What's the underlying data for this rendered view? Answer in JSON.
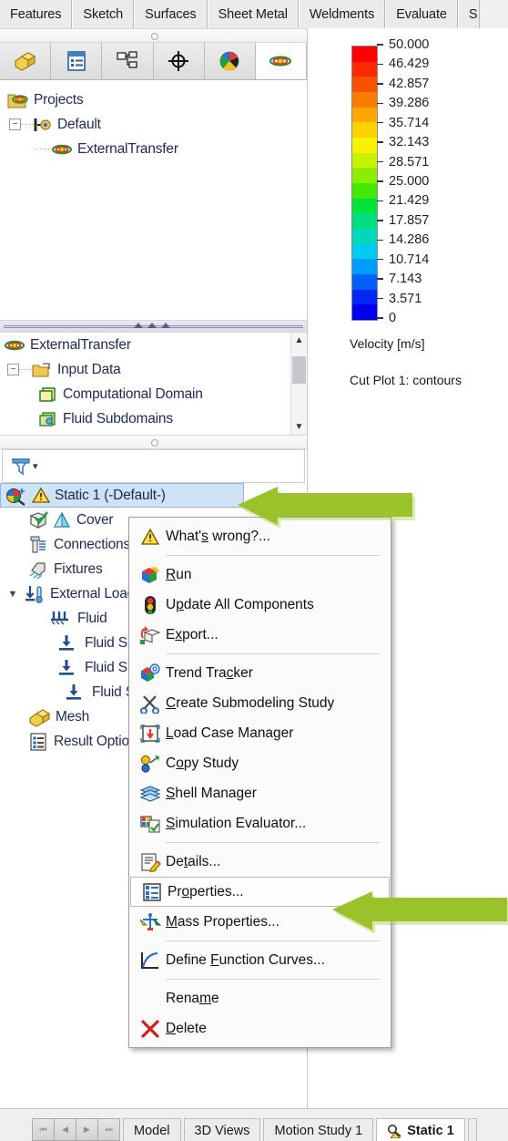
{
  "command_tabs": [
    {
      "label": "Features",
      "icon": "features-tab"
    },
    {
      "label": "Sketch",
      "icon": "sketch-tab"
    },
    {
      "label": "Surfaces",
      "icon": "surfaces-tab"
    },
    {
      "label": "Sheet Metal",
      "icon": "sheet-metal-tab"
    },
    {
      "label": "Weldments",
      "icon": "weldments-tab"
    },
    {
      "label": "Evaluate",
      "icon": "evaluate-tab"
    },
    {
      "label": "S",
      "icon": "simulation-tab-partial"
    }
  ],
  "feature_manager_tabs": [
    {
      "name": "feature-manager-design-tree-icon",
      "active": false
    },
    {
      "name": "property-manager-icon",
      "active": false
    },
    {
      "name": "configuration-manager-icon",
      "active": false
    },
    {
      "name": "dimxpert-manager-icon",
      "active": false
    },
    {
      "name": "display-manager-icon",
      "active": false
    },
    {
      "name": "flow-simulation-analysis-tree-icon",
      "active": true
    }
  ],
  "flow_tree": {
    "items": [
      {
        "label": "Projects",
        "icon": "projects-folder-icon",
        "depth": 0,
        "expander": null
      },
      {
        "label": "Default",
        "icon": "default-config-icon",
        "depth": 1,
        "expander": "minus"
      },
      {
        "label": "ExternalTransfer",
        "icon": "flow-project-icon",
        "depth": 2,
        "expander": null
      }
    ]
  },
  "input_tree": {
    "items": [
      {
        "label": "ExternalTransfer",
        "icon": "flow-project-icon",
        "depth": 0,
        "expander": null
      },
      {
        "label": "Input Data",
        "icon": "input-data-folder-icon",
        "depth": 1,
        "expander": "minus"
      },
      {
        "label": "Computational Domain",
        "icon": "computational-domain-icon",
        "depth": 2,
        "expander": null
      },
      {
        "label": "Fluid Subdomains",
        "icon": "fluid-subdomains-icon",
        "depth": 2,
        "expander": null
      }
    ],
    "scrollbar": {
      "up": "▲",
      "down": "▼"
    }
  },
  "filter_bar": {
    "icon": "filter-funnel-icon",
    "caret": "▾"
  },
  "sim_tree": {
    "items": [
      {
        "label": "Static 1 (-Default-)",
        "icon": "study-icon",
        "warn": true,
        "depth": 0,
        "selected": true,
        "expander": null
      },
      {
        "label": "Cover",
        "icon": "part-check-icon",
        "icon2": "solid-body-icon",
        "depth": 1,
        "selected": false,
        "expander": null
      },
      {
        "label": "Connections",
        "icon": "connections-icon",
        "depth": 1,
        "selected": false,
        "expander": null
      },
      {
        "label": "Fixtures",
        "icon": "fixtures-icon",
        "depth": 1,
        "selected": false,
        "expander": null
      },
      {
        "label": "External Loads",
        "icon": "external-loads-icon",
        "depth": 1,
        "selected": false,
        "expander": "caret-down"
      },
      {
        "label": "Fluid ",
        "icon": "fluid-pressure-icon",
        "depth": 2,
        "selected": false,
        "expander": null
      },
      {
        "label": "Fluid S",
        "icon": "fluid-force-icon",
        "depth": 3,
        "selected": false,
        "expander": null
      },
      {
        "label": "Fluid S",
        "icon": "fluid-force-icon",
        "depth": 3,
        "selected": false,
        "expander": null
      },
      {
        "label": "Fluid S",
        "icon": "fluid-force-icon",
        "depth": 3,
        "selected": false,
        "expander": null
      },
      {
        "label": "Mesh",
        "icon": "mesh-icon",
        "depth": 1,
        "selected": false,
        "expander": null
      },
      {
        "label": "Result Options",
        "icon": "result-options-icon",
        "depth": 1,
        "selected": false,
        "expander": null
      }
    ]
  },
  "context_menu": {
    "items": [
      {
        "label": "What's wrong?...",
        "icon": "warning-triangle-icon",
        "accel_index": 5,
        "sep_after": true,
        "highlight": false
      },
      {
        "label": "Run",
        "icon": "run-icon",
        "accel_index": 0,
        "sep_after": false,
        "highlight": false
      },
      {
        "label": "Update All Components",
        "icon": "traffic-light-icon",
        "accel_index": 1,
        "sep_after": false,
        "highlight": false
      },
      {
        "label": "Export...",
        "icon": "export-icon",
        "accel_index": 1,
        "sep_after": true,
        "highlight": false
      },
      {
        "label": "Trend Tracker",
        "icon": "trend-tracker-icon",
        "accel_index": 9,
        "sep_after": false,
        "highlight": false
      },
      {
        "label": "Create Submodeling Study",
        "icon": "scissors-icon",
        "accel_index": 0,
        "sep_after": false,
        "highlight": false
      },
      {
        "label": "Load Case Manager",
        "icon": "load-case-manager-icon",
        "accel_index": 0,
        "sep_after": false,
        "highlight": false
      },
      {
        "label": "Copy Study",
        "icon": "copy-study-icon",
        "accel_index": 1,
        "sep_after": false,
        "highlight": false
      },
      {
        "label": "Shell Manager",
        "icon": "shell-manager-icon",
        "accel_index": 0,
        "sep_after": false,
        "highlight": false
      },
      {
        "label": "Simulation Evaluator...",
        "icon": "simulation-evaluator-icon",
        "accel_index": 0,
        "sep_after": true,
        "highlight": false
      },
      {
        "label": "Details...",
        "icon": "details-icon",
        "accel_index": 2,
        "sep_after": false,
        "highlight": false
      },
      {
        "label": "Properties...",
        "icon": "properties-icon",
        "accel_index": 2,
        "sep_after": false,
        "highlight": true
      },
      {
        "label": "Mass Properties...",
        "icon": "mass-properties-icon",
        "accel_index": 0,
        "sep_after": true,
        "highlight": false
      },
      {
        "label": "Define Function Curves...",
        "icon": "function-curves-icon",
        "accel_index": 7,
        "sep_after": true,
        "highlight": false
      },
      {
        "label": "Rename",
        "icon": null,
        "accel_index": 4,
        "sep_after": false,
        "highlight": false
      },
      {
        "label": "Delete",
        "icon": "delete-x-icon",
        "accel_index": 0,
        "sep_after": false,
        "highlight": false
      }
    ]
  },
  "legend": {
    "title": "Velocity [m/s]",
    "subtitle": "Cut Plot 1: contours",
    "ticks": [
      "50.000",
      "46.429",
      "42.857",
      "39.286",
      "35.714",
      "32.143",
      "28.571",
      "25.000",
      "21.429",
      "17.857",
      "14.286",
      "10.714",
      "7.143",
      "3.571",
      "0"
    ],
    "colors": [
      "#ff0000",
      "#fb2a00",
      "#f85100",
      "#fa7d00",
      "#fca800",
      "#fed200",
      "#f8f200",
      "#c6f400",
      "#8bee00",
      "#45e800",
      "#00e23a",
      "#00dd7e",
      "#00d8bc",
      "#00caf2",
      "#009cfa",
      "#0060f8",
      "#0028f2",
      "#0000ee"
    ]
  },
  "chart_data": {
    "type": "heatmap",
    "title": "Velocity [m/s]",
    "subtitle": "Cut Plot 1: contours",
    "colorbar_label": "Velocity [m/s]",
    "tick_values": [
      50.0,
      46.429,
      42.857,
      39.286,
      35.714,
      32.143,
      28.571,
      25.0,
      21.429,
      17.857,
      14.286,
      10.714,
      7.143,
      3.571,
      0
    ],
    "tick_labels": [
      "50.000",
      "46.429",
      "42.857",
      "39.286",
      "35.714",
      "32.143",
      "28.571",
      "25.000",
      "21.429",
      "17.857",
      "14.286",
      "10.714",
      "7.143",
      "3.571",
      "0"
    ],
    "clim": [
      0,
      50
    ],
    "units": "m/s",
    "colormap": "rainbow",
    "legend_position": "right",
    "grid": false
  },
  "callouts": [
    {
      "name": "arrow-to-static-study",
      "target": "Static 1 (-Default-)",
      "color": "#9ac22b"
    },
    {
      "name": "arrow-to-properties",
      "target": "Properties...",
      "color": "#9ac22b"
    }
  ],
  "bottom_bar": {
    "nav_buttons": [
      "⏮",
      "◀",
      "▶",
      "⏭"
    ],
    "doc_tabs": [
      {
        "label": "Model",
        "active": false,
        "icon": null
      },
      {
        "label": "3D Views",
        "active": false,
        "icon": null
      },
      {
        "label": "Motion Study 1",
        "active": false,
        "icon": null
      },
      {
        "label": "Static 1",
        "active": true,
        "icon": "study-warn-icon"
      }
    ]
  },
  "colors": {
    "accent_green": "#9ac22b",
    "selection_blue": "#cfe3f7",
    "tree_text": "#1d2a52"
  }
}
